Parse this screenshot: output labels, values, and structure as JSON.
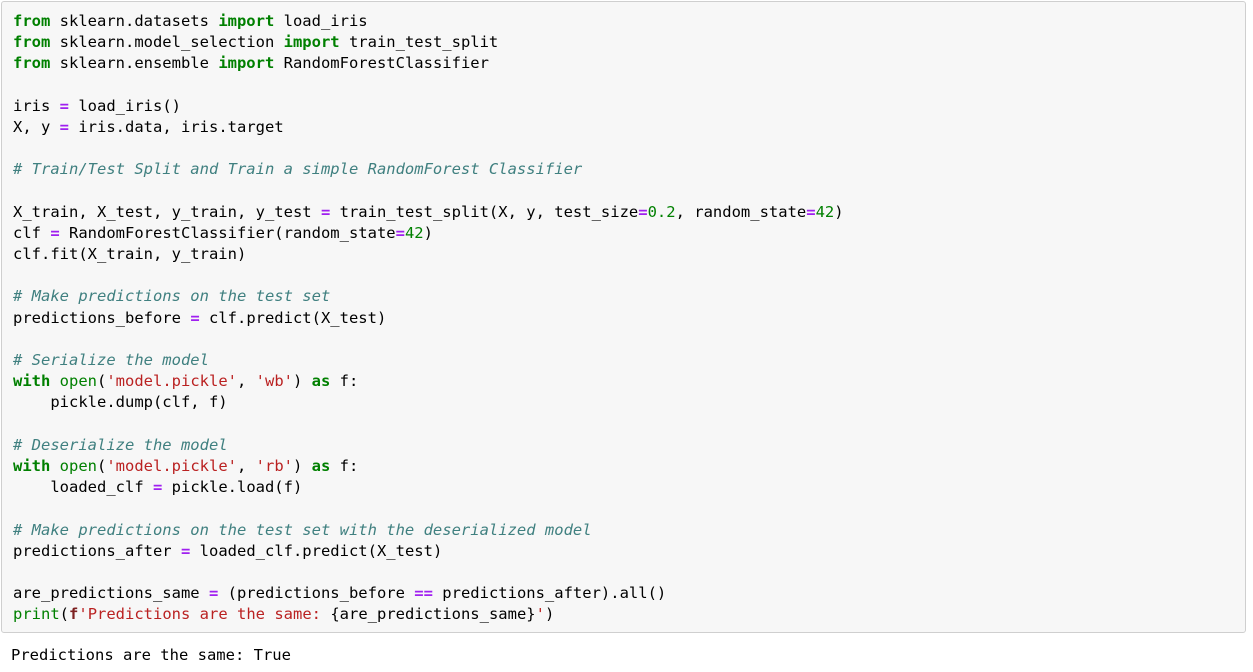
{
  "code_block": {
    "language": "python",
    "background_color": "#f7f7f7",
    "border_color": "#cfcfcf",
    "lines": [
      "from sklearn.datasets import load_iris",
      "from sklearn.model_selection import train_test_split",
      "from sklearn.ensemble import RandomForestClassifier",
      "",
      "iris = load_iris()",
      "X, y = iris.data, iris.target",
      "",
      "# Train/Test Split and Train a simple RandomForest Classifier",
      "",
      "X_train, X_test, y_train, y_test = train_test_split(X, y, test_size=0.2, random_state=42)",
      "clf = RandomForestClassifier(random_state=42)",
      "clf.fit(X_train, y_train)",
      "",
      "# Make predictions on the test set",
      "predictions_before = clf.predict(X_test)",
      "",
      "# Serialize the model",
      "with open('model.pickle', 'wb') as f:",
      "    pickle.dump(clf, f)",
      "",
      "# Deserialize the model",
      "with open('model.pickle', 'rb') as f:",
      "    loaded_clf = pickle.load(f)",
      "",
      "# Make predictions on the test set with the deserialized model",
      "predictions_after = loaded_clf.predict(X_test)",
      "",
      "are_predictions_same = (predictions_before == predictions_after).all()",
      "print(f'Predictions are the same: {are_predictions_same}')"
    ],
    "tokens": {
      "keywords": [
        "from",
        "import",
        "with",
        "as"
      ],
      "builtins": [
        "open",
        "print"
      ],
      "strings": [
        "'model.pickle'",
        "'wb'",
        "'rb'",
        "f'Predictions are the same: {are_predictions_same}'"
      ],
      "numbers": [
        "0.2",
        "42"
      ],
      "comments": [
        "# Train/Test Split and Train a simple RandomForest Classifier",
        "# Make predictions on the test set",
        "# Serialize the model",
        "# Deserialize the model",
        "# Make predictions on the test set with the deserialized model"
      ],
      "operators": [
        "=",
        "=="
      ]
    },
    "syntax_colors": {
      "keyword": "#008000",
      "builtin": "#008000",
      "comment": "#408080",
      "string": "#ba2121",
      "string_affix": "#7d2121",
      "number": "#008000",
      "operator": "#a020f0",
      "plain": "#000000"
    }
  },
  "output": {
    "text": "Predictions are the same: True"
  }
}
